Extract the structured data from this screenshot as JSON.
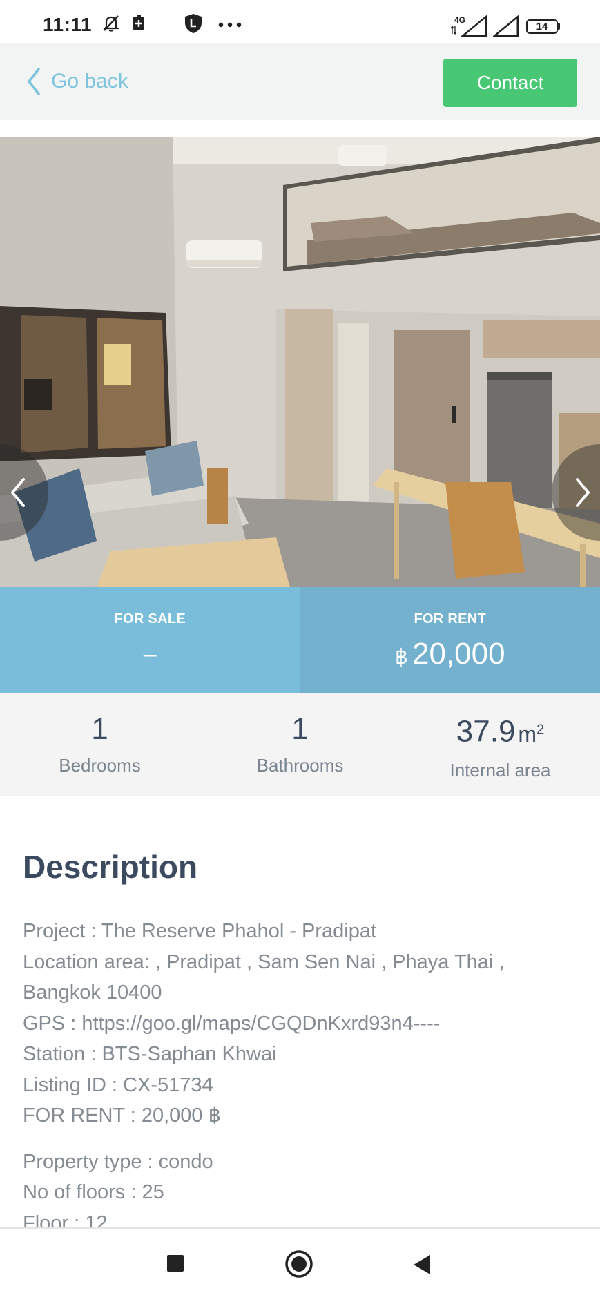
{
  "status_bar": {
    "time": "11:11",
    "network": "4G",
    "battery": "14",
    "icons": [
      "mute-bell-icon",
      "battery-saver-icon",
      "vpn-shield-icon",
      "more-icon",
      "signal-icon",
      "signal-icon-2",
      "battery-icon"
    ]
  },
  "header": {
    "back_label": "Go back",
    "contact_label": "Contact",
    "accent_color": "#7ec4df",
    "contact_color": "#48c774"
  },
  "gallery": {
    "prev_icon": "chevron-left-icon",
    "next_icon": "chevron-right-icon"
  },
  "price": {
    "sale_label": "FOR SALE",
    "sale_value": "–",
    "rent_label": "FOR RENT",
    "currency": "฿",
    "rent_value": "20,000",
    "sale_color": "#79bddb",
    "rent_color": "#73b1cf"
  },
  "stats": {
    "bedrooms_value": "1",
    "bedrooms_label": "Bedrooms",
    "bathrooms_value": "1",
    "bathrooms_label": "Bathrooms",
    "area_value": "37.9",
    "area_unit": "m",
    "area_sup": "2",
    "area_label": "Internal area"
  },
  "description": {
    "title": "Description",
    "lines": [
      "Project : The Reserve Phahol - Pradipat",
      "Location area: , Pradipat , Sam Sen Nai , Phaya Thai ,",
      "Bangkok 10400",
      "GPS : https://goo.gl/maps/CGQDnKxrd93n4----",
      "Station : BTS-Saphan Khwai",
      "Listing ID : CX-51734",
      "FOR RENT : 20,000 ฿"
    ],
    "lines2": [
      "Property type : condo",
      "No of floors : 25",
      "Floor : 12"
    ]
  },
  "bottom_nav": {
    "icons": [
      "recents-square-icon",
      "home-circle-icon",
      "back-triangle-icon"
    ]
  }
}
